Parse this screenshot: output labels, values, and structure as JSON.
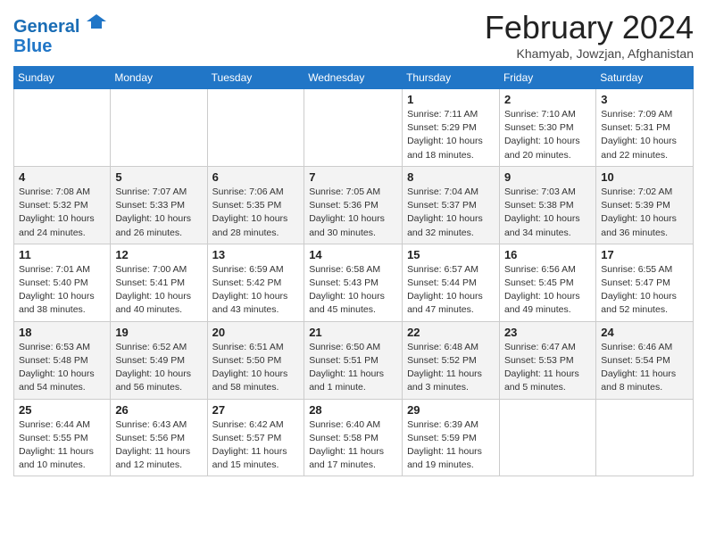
{
  "logo": {
    "line1": "General",
    "line2": "Blue"
  },
  "title": "February 2024",
  "subtitle": "Khamyab, Jowzjan, Afghanistan",
  "days_of_week": [
    "Sunday",
    "Monday",
    "Tuesday",
    "Wednesday",
    "Thursday",
    "Friday",
    "Saturday"
  ],
  "weeks": [
    [
      {
        "day": "",
        "detail": ""
      },
      {
        "day": "",
        "detail": ""
      },
      {
        "day": "",
        "detail": ""
      },
      {
        "day": "",
        "detail": ""
      },
      {
        "day": "1",
        "detail": "Sunrise: 7:11 AM\nSunset: 5:29 PM\nDaylight: 10 hours\nand 18 minutes."
      },
      {
        "day": "2",
        "detail": "Sunrise: 7:10 AM\nSunset: 5:30 PM\nDaylight: 10 hours\nand 20 minutes."
      },
      {
        "day": "3",
        "detail": "Sunrise: 7:09 AM\nSunset: 5:31 PM\nDaylight: 10 hours\nand 22 minutes."
      }
    ],
    [
      {
        "day": "4",
        "detail": "Sunrise: 7:08 AM\nSunset: 5:32 PM\nDaylight: 10 hours\nand 24 minutes."
      },
      {
        "day": "5",
        "detail": "Sunrise: 7:07 AM\nSunset: 5:33 PM\nDaylight: 10 hours\nand 26 minutes."
      },
      {
        "day": "6",
        "detail": "Sunrise: 7:06 AM\nSunset: 5:35 PM\nDaylight: 10 hours\nand 28 minutes."
      },
      {
        "day": "7",
        "detail": "Sunrise: 7:05 AM\nSunset: 5:36 PM\nDaylight: 10 hours\nand 30 minutes."
      },
      {
        "day": "8",
        "detail": "Sunrise: 7:04 AM\nSunset: 5:37 PM\nDaylight: 10 hours\nand 32 minutes."
      },
      {
        "day": "9",
        "detail": "Sunrise: 7:03 AM\nSunset: 5:38 PM\nDaylight: 10 hours\nand 34 minutes."
      },
      {
        "day": "10",
        "detail": "Sunrise: 7:02 AM\nSunset: 5:39 PM\nDaylight: 10 hours\nand 36 minutes."
      }
    ],
    [
      {
        "day": "11",
        "detail": "Sunrise: 7:01 AM\nSunset: 5:40 PM\nDaylight: 10 hours\nand 38 minutes."
      },
      {
        "day": "12",
        "detail": "Sunrise: 7:00 AM\nSunset: 5:41 PM\nDaylight: 10 hours\nand 40 minutes."
      },
      {
        "day": "13",
        "detail": "Sunrise: 6:59 AM\nSunset: 5:42 PM\nDaylight: 10 hours\nand 43 minutes."
      },
      {
        "day": "14",
        "detail": "Sunrise: 6:58 AM\nSunset: 5:43 PM\nDaylight: 10 hours\nand 45 minutes."
      },
      {
        "day": "15",
        "detail": "Sunrise: 6:57 AM\nSunset: 5:44 PM\nDaylight: 10 hours\nand 47 minutes."
      },
      {
        "day": "16",
        "detail": "Sunrise: 6:56 AM\nSunset: 5:45 PM\nDaylight: 10 hours\nand 49 minutes."
      },
      {
        "day": "17",
        "detail": "Sunrise: 6:55 AM\nSunset: 5:47 PM\nDaylight: 10 hours\nand 52 minutes."
      }
    ],
    [
      {
        "day": "18",
        "detail": "Sunrise: 6:53 AM\nSunset: 5:48 PM\nDaylight: 10 hours\nand 54 minutes."
      },
      {
        "day": "19",
        "detail": "Sunrise: 6:52 AM\nSunset: 5:49 PM\nDaylight: 10 hours\nand 56 minutes."
      },
      {
        "day": "20",
        "detail": "Sunrise: 6:51 AM\nSunset: 5:50 PM\nDaylight: 10 hours\nand 58 minutes."
      },
      {
        "day": "21",
        "detail": "Sunrise: 6:50 AM\nSunset: 5:51 PM\nDaylight: 11 hours\nand 1 minute."
      },
      {
        "day": "22",
        "detail": "Sunrise: 6:48 AM\nSunset: 5:52 PM\nDaylight: 11 hours\nand 3 minutes."
      },
      {
        "day": "23",
        "detail": "Sunrise: 6:47 AM\nSunset: 5:53 PM\nDaylight: 11 hours\nand 5 minutes."
      },
      {
        "day": "24",
        "detail": "Sunrise: 6:46 AM\nSunset: 5:54 PM\nDaylight: 11 hours\nand 8 minutes."
      }
    ],
    [
      {
        "day": "25",
        "detail": "Sunrise: 6:44 AM\nSunset: 5:55 PM\nDaylight: 11 hours\nand 10 minutes."
      },
      {
        "day": "26",
        "detail": "Sunrise: 6:43 AM\nSunset: 5:56 PM\nDaylight: 11 hours\nand 12 minutes."
      },
      {
        "day": "27",
        "detail": "Sunrise: 6:42 AM\nSunset: 5:57 PM\nDaylight: 11 hours\nand 15 minutes."
      },
      {
        "day": "28",
        "detail": "Sunrise: 6:40 AM\nSunset: 5:58 PM\nDaylight: 11 hours\nand 17 minutes."
      },
      {
        "day": "29",
        "detail": "Sunrise: 6:39 AM\nSunset: 5:59 PM\nDaylight: 11 hours\nand 19 minutes."
      },
      {
        "day": "",
        "detail": ""
      },
      {
        "day": "",
        "detail": ""
      }
    ]
  ]
}
